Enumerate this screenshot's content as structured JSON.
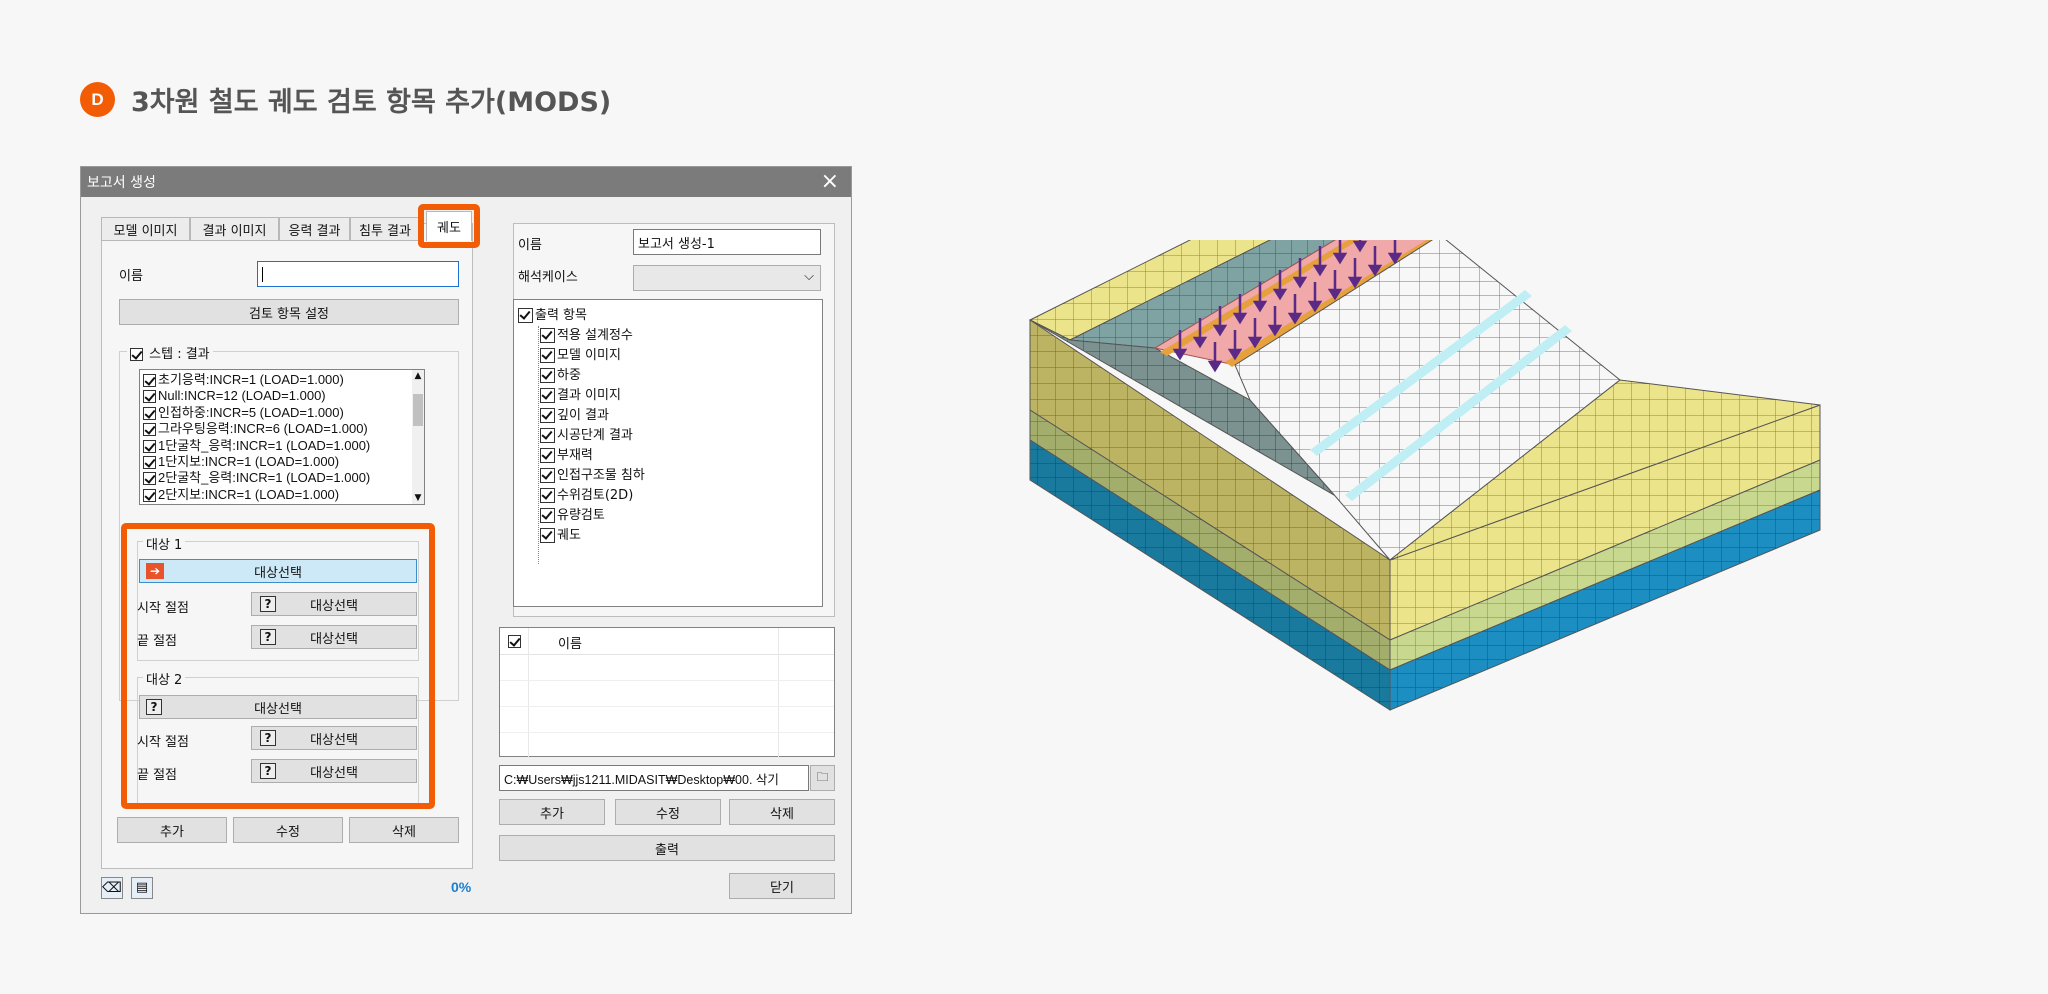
{
  "heading": {
    "badge": "D",
    "title": "3차원 철도 궤도 검토 항목 추가(MODS)"
  },
  "dialog": {
    "title": "보고서 생성",
    "tabs": [
      "모델 이미지",
      "결과 이미지",
      "응력 결과",
      "침투 결과",
      "궤도"
    ],
    "left": {
      "name_label": "이름",
      "name_value": "",
      "review_button": "검토 항목 설정",
      "step_group": "스텝 : 결과",
      "steps": [
        "초기응력:INCR=1 (LOAD=1.000)",
        "Null:INCR=12 (LOAD=1.000)",
        "인접하중:INCR=5 (LOAD=1.000)",
        "그라우팅응력:INCR=6 (LOAD=1.000)",
        "1단굴착_응력:INCR=1 (LOAD=1.000)",
        "1단지보:INCR=1 (LOAD=1.000)",
        "2단굴착_응력:INCR=1 (LOAD=1.000)",
        "2단지보:INCR=1 (LOAD=1.000)"
      ],
      "target1": {
        "title": "대상 1",
        "select": "대상선택",
        "start_label": "시작 절점",
        "start_btn": "대상선택",
        "end_label": "끝 절점",
        "end_btn": "대상선택"
      },
      "target2": {
        "title": "대상 2",
        "select": "대상선택",
        "start_label": "시작 절점",
        "start_btn": "대상선택",
        "end_label": "끝 절점",
        "end_btn": "대상선택"
      },
      "add": "추가",
      "edit": "수정",
      "delete": "삭제"
    },
    "right": {
      "name_label": "이름",
      "name_value": "보고서 생성-1",
      "case_label": "해석케이스",
      "case_value": "",
      "tree_root": "출력 항목",
      "tree_items": [
        "적용 설계정수",
        "모델 이미지",
        "하중",
        "결과 이미지",
        "깊이 결과",
        "시공단계 결과",
        "부재력",
        "인접구조물 침하",
        "수위검토(2D)",
        "유량검토",
        "궤도"
      ],
      "table_header": "이름",
      "path": "C:₩Users₩jjs1211.MIDASIT₩Desktop₩00. 삭기",
      "add": "추가",
      "edit": "수정",
      "delete": "삭제",
      "output": "출력",
      "close": "닫기"
    },
    "progress": "0%"
  },
  "colors": {
    "accent": "#f25c05",
    "progress": "#1a7fd0",
    "yellow": "#e6df7a",
    "blue": "#1b7fa6"
  }
}
